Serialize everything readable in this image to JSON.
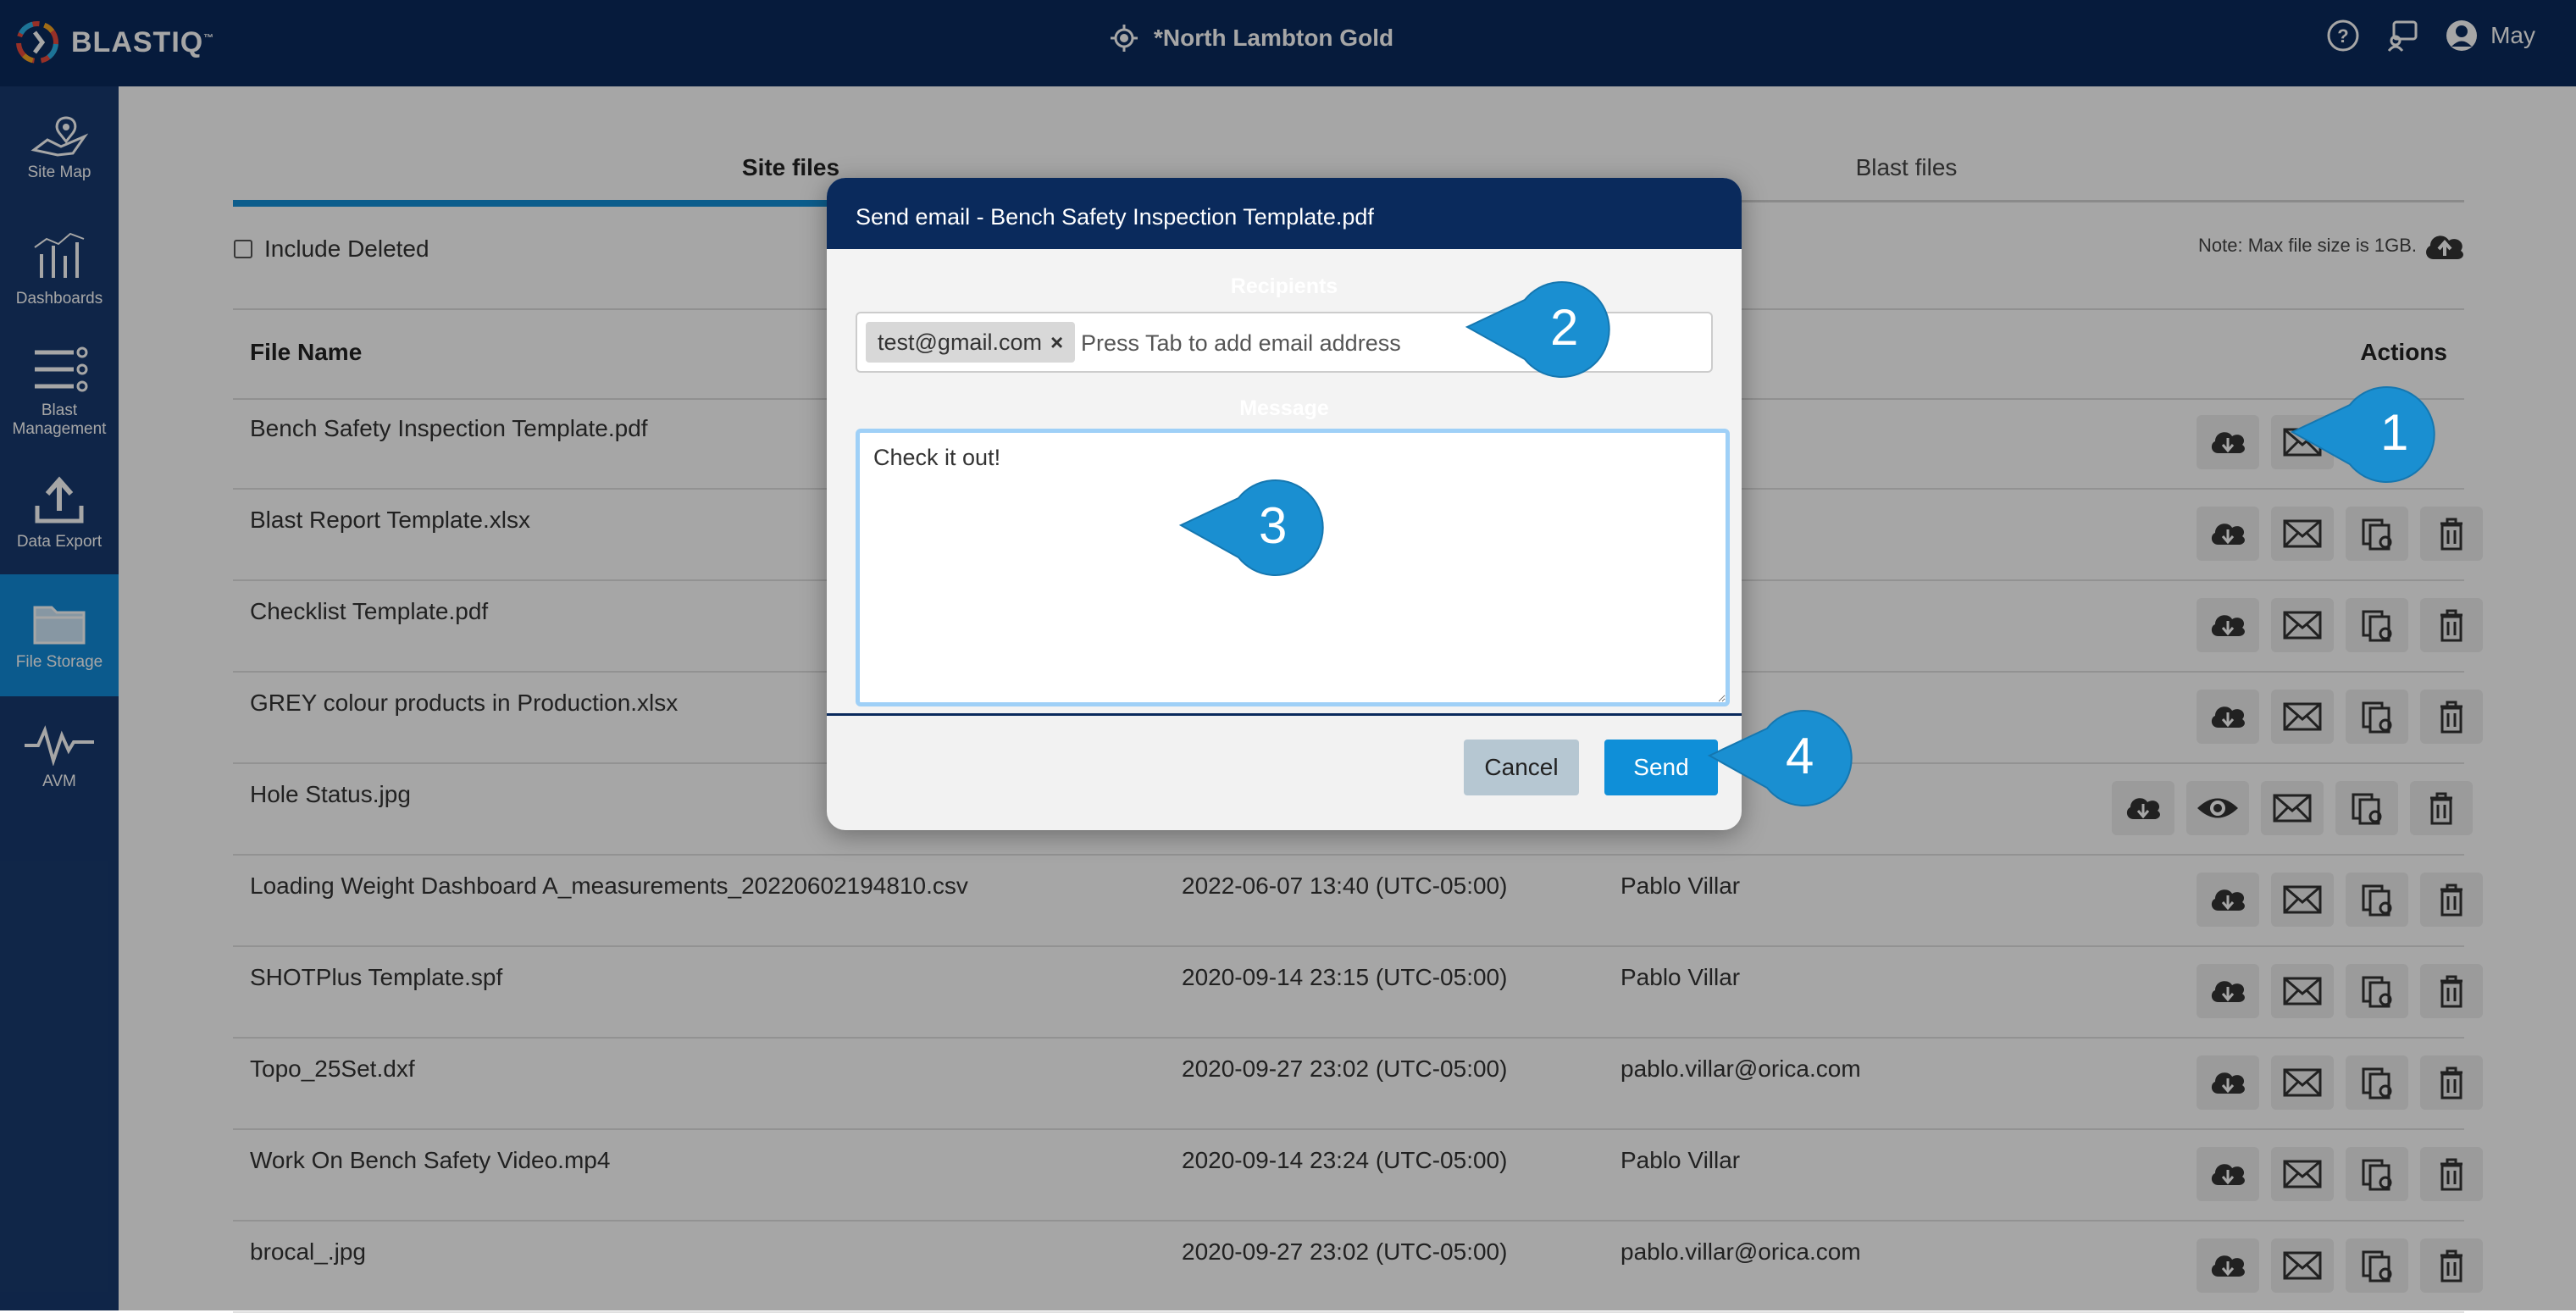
{
  "app": {
    "logo_text": "BLASTIQ",
    "logo_tm": "™",
    "site_name": "*North Lambton Gold",
    "user_name": "May"
  },
  "sidebar": {
    "items": [
      {
        "label": "Site Map",
        "icon": "map-icon",
        "active": false
      },
      {
        "label": "Dashboards",
        "icon": "dashboard-chart-icon",
        "active": false
      },
      {
        "label": "Blast Management",
        "icon": "list-management-icon",
        "active": false
      },
      {
        "label": "Data Export",
        "icon": "upload-icon",
        "active": false
      },
      {
        "label": "File Storage",
        "icon": "folder-icon",
        "active": true
      },
      {
        "label": "AVM",
        "icon": "waveform-icon",
        "active": false
      }
    ]
  },
  "tabs": [
    {
      "label": "Site files",
      "active": true
    },
    {
      "label": "Blast files",
      "active": false
    }
  ],
  "filters": {
    "include_deleted_label": "Include Deleted",
    "include_deleted_checked": false
  },
  "note": "Note: Max file size is 1GB.",
  "table": {
    "columns": {
      "file_name": "File Name",
      "actions": "Actions"
    },
    "rows": [
      {
        "name": "Bench Safety Inspection Template.pdf",
        "date": "",
        "by": ""
      },
      {
        "name": "Blast Report Template.xlsx",
        "date": "",
        "by": ""
      },
      {
        "name": "Checklist Template.pdf",
        "date": "",
        "by": ""
      },
      {
        "name": "GREY colour products in Production.xlsx",
        "date": "",
        "by": ""
      },
      {
        "name": "Hole Status.jpg",
        "date": "",
        "by": ""
      },
      {
        "name": "Loading Weight Dashboard A_measurements_20220602194810.csv",
        "date": "2022-06-07 13:40 (UTC-05:00)",
        "by": "Pablo Villar"
      },
      {
        "name": "SHOTPlus Template.spf",
        "date": "2020-09-14 23:15 (UTC-05:00)",
        "by": "Pablo Villar"
      },
      {
        "name": "Topo_25Set.dxf",
        "date": "2020-09-27 23:02 (UTC-05:00)",
        "by": "pablo.villar@orica.com"
      },
      {
        "name": "Work On Bench Safety Video.mp4",
        "date": "2020-09-14 23:24 (UTC-05:00)",
        "by": "Pablo Villar"
      },
      {
        "name": "brocal_.jpg",
        "date": "2020-09-27 23:02 (UTC-05:00)",
        "by": "pablo.villar@orica.com"
      }
    ]
  },
  "modal": {
    "title": "Send email - Bench Safety Inspection Template.pdf",
    "recipients_label": "Recipients",
    "recipient_chip": "test@gmail.com",
    "recipient_chip_remove": "×",
    "recipient_placeholder": "Press Tab to add email address",
    "message_label": "Message",
    "message_value": "Check it out!",
    "cancel_label": "Cancel",
    "send_label": "Send"
  },
  "callouts": {
    "one": "1",
    "two": "2",
    "three": "3",
    "four": "4",
    "color": "#1a8fd1"
  }
}
